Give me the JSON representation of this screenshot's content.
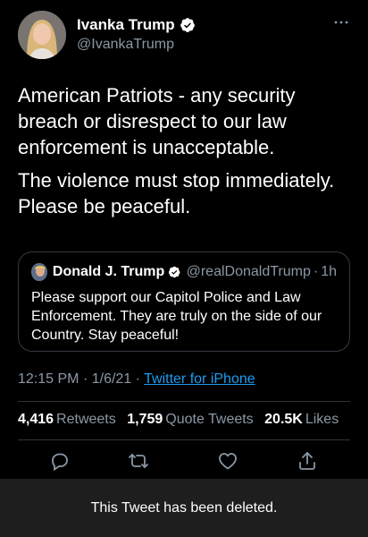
{
  "author": {
    "display_name": "Ivanka Trump",
    "handle": "@IvankaTrump"
  },
  "tweet": {
    "paragraphs": [
      "American Patriots - any security breach or disrespect to our law enforcement is unacceptable.",
      "The violence must stop immediately. Please be peaceful."
    ]
  },
  "quoted_tweet": {
    "display_name": "Donald J. Trump",
    "handle": "@realDonaldTrump",
    "separator": "·",
    "time": "1h",
    "text": "Please support our Capitol Police and Law Enforcement. They are truly on the side of our Country. Stay peaceful!"
  },
  "meta": {
    "time": "12:15 PM",
    "date": "1/6/21",
    "separator": "·",
    "source": "Twitter for iPhone"
  },
  "stats": {
    "retweets_count": "4,416",
    "retweets_label": "Retweets",
    "quote_count": "1,759",
    "quote_label": "Quote Tweets",
    "likes_count": "20.5K",
    "likes_label": "Likes"
  },
  "actions": [
    "reply-icon",
    "retweet-icon",
    "like-icon",
    "share-icon"
  ],
  "banner": {
    "message": "This Tweet has been deleted."
  },
  "colors": {
    "background": "#000000",
    "accent": "#1d9bf0",
    "muted": "#8b98a5",
    "banner_bg": "#1e1e1e"
  }
}
